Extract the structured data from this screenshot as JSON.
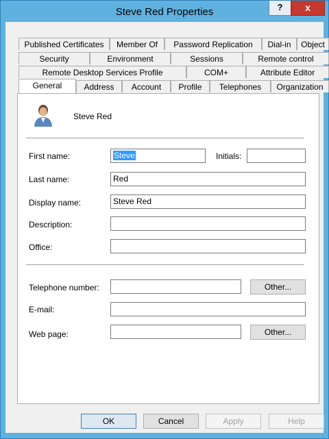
{
  "window": {
    "title": "Steve Red Properties",
    "help": "?",
    "close": "x"
  },
  "tabs": {
    "row1": [
      "Published Certificates",
      "Member Of",
      "Password Replication",
      "Dial-in",
      "Object"
    ],
    "row2": [
      "Security",
      "Environment",
      "Sessions",
      "Remote control"
    ],
    "row3": [
      "Remote Desktop Services Profile",
      "COM+",
      "Attribute Editor"
    ],
    "row4": [
      "General",
      "Address",
      "Account",
      "Profile",
      "Telephones",
      "Organization"
    ]
  },
  "user": {
    "display": "Steve Red"
  },
  "form": {
    "first_name_label": "First name:",
    "first_name_value": "Steve",
    "initials_label": "Initials:",
    "initials_value": "",
    "last_name_label": "Last name:",
    "last_name_value": "Red",
    "display_name_label": "Display name:",
    "display_name_value": "Steve Red",
    "description_label": "Description:",
    "description_value": "",
    "office_label": "Office:",
    "office_value": "",
    "telephone_label": "Telephone number:",
    "telephone_value": "",
    "other_label": "Other...",
    "email_label": "E-mail:",
    "email_value": "",
    "webpage_label": "Web page:",
    "webpage_value": ""
  },
  "buttons": {
    "ok": "OK",
    "cancel": "Cancel",
    "apply": "Apply",
    "help": "Help"
  },
  "colors": {
    "titlebar": "#5fb1df",
    "selection": "#3399ff",
    "close": "#c7382e"
  }
}
